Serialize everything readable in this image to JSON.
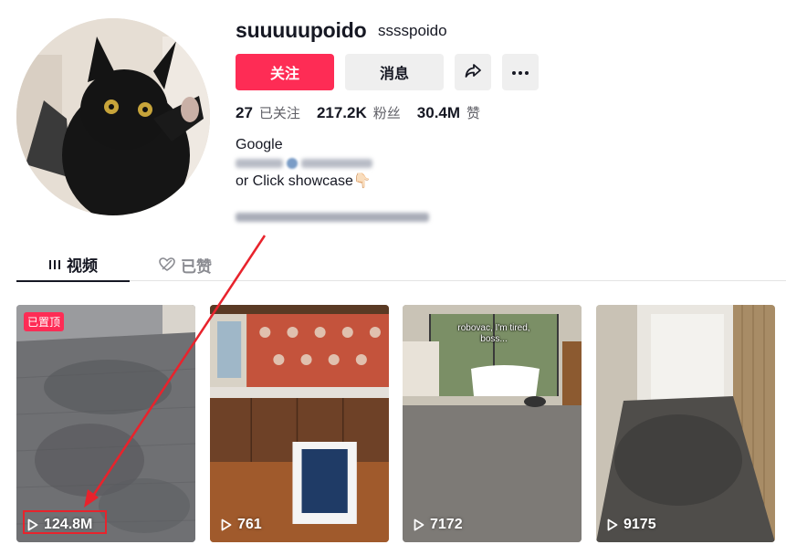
{
  "profile": {
    "username": "suuuuupoido",
    "nickname": "sssspoido",
    "follow_label": "关注",
    "message_label": "消息",
    "stats": [
      {
        "value": "27",
        "label": "已关注"
      },
      {
        "value": "217.2K",
        "label": "粉丝"
      },
      {
        "value": "30.4M",
        "label": "赞"
      }
    ],
    "bio_line1": "Google",
    "bio_line3": "or Click showcase👇🏻"
  },
  "tabs": {
    "videos": "视频",
    "liked": "已赞"
  },
  "videos": [
    {
      "views": "124.8M",
      "pinned": "已置顶"
    },
    {
      "views": "761"
    },
    {
      "views": "7172",
      "caption": "robovac, I'm tired, boss..."
    },
    {
      "views": "9175"
    }
  ],
  "colors": {
    "accent": "#fe2c55",
    "annotation": "#e8232c"
  }
}
